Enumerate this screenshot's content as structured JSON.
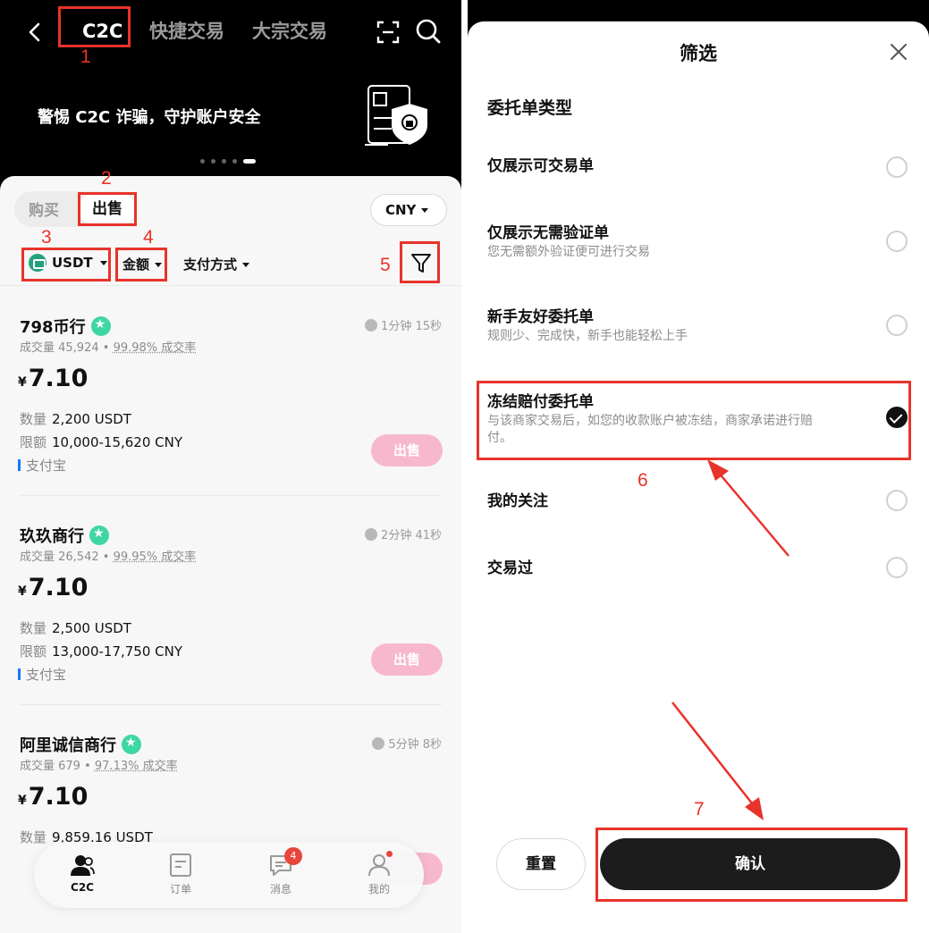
{
  "left": {
    "nav": {
      "tabs": [
        "C2C",
        "快捷交易",
        "大宗交易"
      ]
    },
    "banner": {
      "text": "警惕 C2C 诈骗，守护账户安全",
      "dots": 5
    },
    "segment": {
      "buy": "购买",
      "sell": "出售"
    },
    "currency": "CNY",
    "filters": {
      "coin": "USDT",
      "amount": "金额",
      "payment": "支付方式"
    },
    "labels": {
      "qty": "数量",
      "limit": "限额",
      "yen": "¥",
      "sell_btn": "出售"
    },
    "ads": [
      {
        "name": "798币行",
        "time": "1分钟 15秒",
        "volume": "成交量 45,924",
        "rate": "99.98% 成交率",
        "price": "7.10",
        "qty": "2,200 USDT",
        "limit": "10,000-15,620 CNY",
        "pay": "支付宝"
      },
      {
        "name": "玖玖商行",
        "time": "2分钟 41秒",
        "volume": "成交量 26,542",
        "rate": "99.95% 成交率",
        "price": "7.10",
        "qty": "2,500 USDT",
        "limit": "13,000-17,750 CNY",
        "pay": "支付宝"
      },
      {
        "name": "阿里诚信商行",
        "time": "5分钟 8秒",
        "volume": "成交量 679",
        "rate": "97.13% 成交率",
        "price": "7.10",
        "qty": "9,859.16 USDT",
        "limit": "",
        "pay": ""
      }
    ],
    "bottom_nav": [
      {
        "label": "C2C"
      },
      {
        "label": "订单"
      },
      {
        "label": "消息",
        "badge": "4"
      },
      {
        "label": "我的"
      }
    ]
  },
  "right": {
    "title": "筛选",
    "section": "委托单类型",
    "options": [
      {
        "label": "仅展示可交易单",
        "desc": "",
        "checked": false
      },
      {
        "label": "仅展示无需验证单",
        "desc": "您无需额外验证便可进行交易",
        "checked": false
      },
      {
        "label": "新手友好委托单",
        "desc": "规则少、完成快，新手也能轻松上手",
        "checked": false
      },
      {
        "label": "冻结赔付委托单",
        "desc": "与该商家交易后，如您的收款账户被冻结，商家承诺进行赔付。",
        "checked": true
      },
      {
        "label": "我的关注",
        "desc": "",
        "checked": false
      },
      {
        "label": "交易过",
        "desc": "",
        "checked": false
      }
    ],
    "reset": "重置",
    "confirm": "确认"
  },
  "annotations": [
    "1",
    "2",
    "3",
    "4",
    "5",
    "6",
    "7"
  ],
  "colors": {
    "annotation": "#e8332a",
    "sell_button": "#f7b8cd",
    "verified": "#3fd6a6",
    "coin": "#26a17b"
  }
}
